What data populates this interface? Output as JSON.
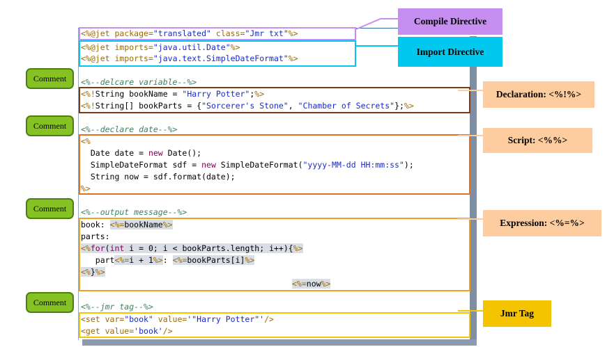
{
  "labels": {
    "compile": "Compile Directive",
    "import": "Import Directive",
    "declaration": "Declaration: <%!%>",
    "script": "Script: <%%>",
    "expression": "Expression: <%=%>",
    "jmr_tag": "Jmr Tag",
    "comment": "Comment"
  },
  "code": {
    "l1": {
      "a": "<%@",
      "b": "jet package=",
      "c": "\"translated\"",
      "d": " class=",
      "e": "\"Jmr txt\"",
      "f": "%>"
    },
    "l2": {
      "a": "<%@",
      "b": "jet imports=",
      "c": "\"java.util.Date\"",
      "f": "%>"
    },
    "l3": {
      "a": "<%@",
      "b": "jet imports=",
      "c": "\"java.text.SimpleDateFormat\"",
      "f": "%>"
    },
    "l4": "<%--delcare variable--%>",
    "l5": {
      "a": "<%!",
      "b": "String bookName = ",
      "c": "\"Harry Potter\"",
      "d": ";",
      "f": "%>"
    },
    "l6": {
      "a": "<%!",
      "b": "String[] bookParts = {",
      "c": "\"Sorcerer's Stone\"",
      "d": ", ",
      "e": "\"Chamber of Secrets\"",
      "g": "};",
      "f": "%>"
    },
    "l7": "<%--declare date--%>",
    "l8": "<%",
    "l9": {
      "a": "  Date date = ",
      "k": "new",
      "b": " Date();"
    },
    "l10": {
      "a": "  SimpleDateFormat sdf = ",
      "k": "new",
      "b": " SimpleDateFormat(",
      "c": "\"yyyy-MM-dd HH:mm:ss\"",
      "d": ");"
    },
    "l11": "  String now = sdf.format(date);",
    "l12": "%>",
    "l13": "<%--output message--%>",
    "l14": {
      "a": "book: ",
      "m1": "<%=",
      "b": "bookName",
      "m2": "%>"
    },
    "l15": "parts:",
    "l16": {
      "m1": "<%",
      "k1": "for",
      "a": "(",
      "k2": "int",
      "b": " i = 0; i < bookParts.length; i++){",
      "m2": "%>"
    },
    "l17": {
      "a": "   part",
      "m1": "<%=",
      "b": "i + 1",
      "m2": "%>",
      "c": ": ",
      "m3": "<%=",
      "d": "bookParts[i]",
      "m4": "%>"
    },
    "l18": {
      "m1": "<%",
      "a": "}",
      "m2": "%>"
    },
    "l19": {
      "m1": "<%=",
      "a": "now",
      "m2": "%>"
    },
    "l20": "<%--jmr tag--%>",
    "l21": {
      "a": "<set var=",
      "b": "\"book\"",
      "c": " value=",
      "d": "'\"Harry Potter\"'",
      "e": "/>"
    },
    "l22": {
      "a": "<get value=",
      "b": "'book'",
      "e": "/>"
    }
  },
  "colors": {
    "compile": "#c78ef2",
    "import": "#00c8ee",
    "declaration_box": "#7a3b13",
    "script_box": "#e2701e",
    "expression_box": "#f0a31a",
    "jmr_box": "#f5c400",
    "callout": "#fdcda0",
    "comment": "#86c322"
  }
}
